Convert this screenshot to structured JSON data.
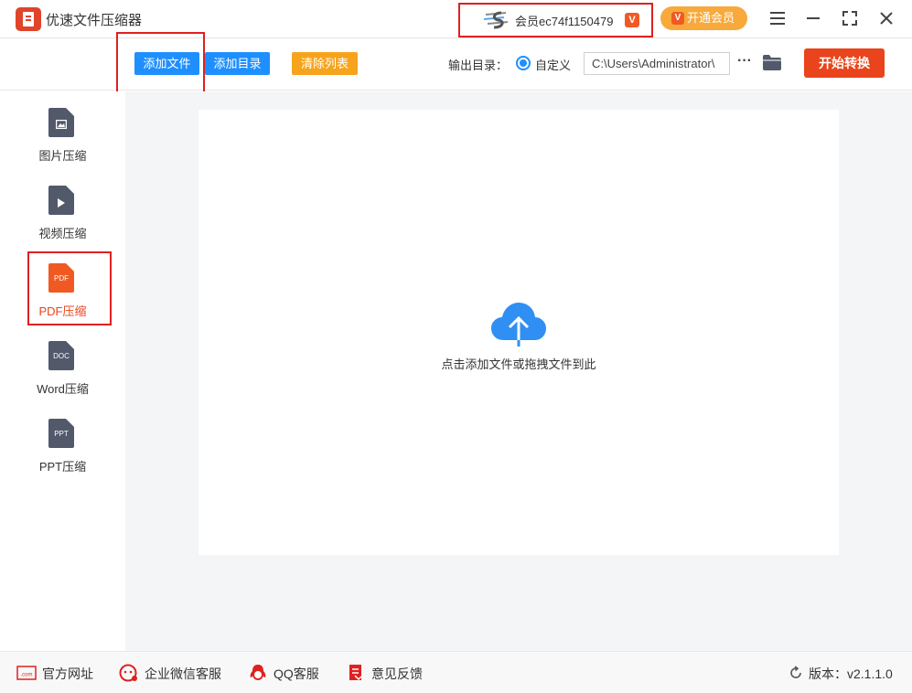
{
  "app": {
    "title": "优速文件压缩器"
  },
  "account": {
    "member_label": "会员ec74f1150479",
    "vip_badge": "V",
    "open_vip_label": "开通会员"
  },
  "toolbar": {
    "add_file": "添加文件",
    "add_dir": "添加目录",
    "clear_list": "清除列表",
    "output_label": "输出目录：",
    "custom_label": "自定义",
    "output_path": "C:\\Users\\Administrator\\",
    "more": "···",
    "start": "开始转换"
  },
  "sidebar": {
    "items": [
      {
        "label": "图片压缩",
        "icon": "image-file-icon",
        "glyph": "▣"
      },
      {
        "label": "视频压缩",
        "icon": "video-file-icon",
        "glyph": "▶"
      },
      {
        "label": "PDF压缩",
        "icon": "pdf-file-icon",
        "glyph": "PDF"
      },
      {
        "label": "Word压缩",
        "icon": "doc-file-icon",
        "glyph": "DOC"
      },
      {
        "label": "PPT压缩",
        "icon": "ppt-file-icon",
        "glyph": "PPT"
      }
    ],
    "active_index": 2
  },
  "main": {
    "drop_hint": "点击添加文件或拖拽文件到此"
  },
  "footer": {
    "website": "官方网址",
    "wechat": "企业微信客服",
    "qq": "QQ客服",
    "feedback": "意见反馈",
    "version": "版本：v2.1.1.0"
  },
  "colors": {
    "brand_red": "#e9441b",
    "primary_blue": "#1e8fff",
    "orange": "#f7a41d",
    "highlight_red": "#e02020",
    "icon_gray": "#52596b"
  }
}
